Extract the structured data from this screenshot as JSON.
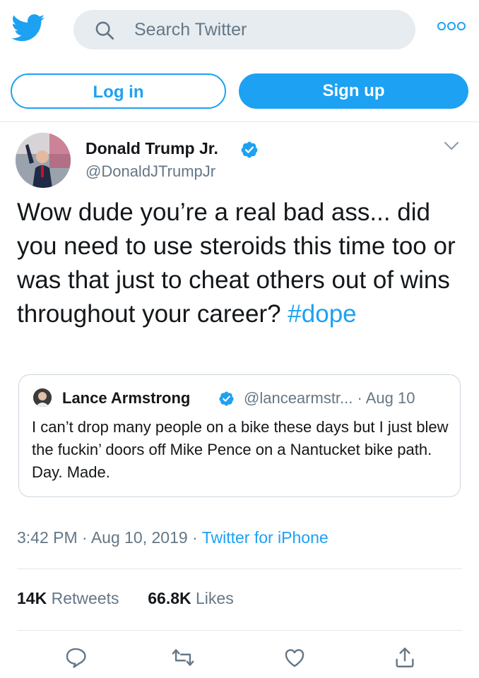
{
  "search": {
    "placeholder": "Search Twitter"
  },
  "auth": {
    "login_label": "Log in",
    "signup_label": "Sign up"
  },
  "tweet": {
    "author_name": "Donald Trump Jr.",
    "author_handle": "@DonaldJTrumpJr",
    "text_main": "Wow dude you’re a real bad ass... did you need to use steroids this time too or was that just to cheat others out of wins throughout your career? ",
    "hashtag": "#dope",
    "quote": {
      "author_name": "Lance Armstrong",
      "author_handle": "@lancearmstr... · Aug 10",
      "text": "I can’t drop many people on a bike these days but I just blew the fuckin’ doors off Mike Pence on a Nantucket bike path. Day. Made."
    },
    "time": "3:42 PM · Aug 10, 2019 · ",
    "source": "Twitter for iPhone",
    "retweets_count": "14K",
    "retweets_label": " Retweets",
    "likes_count": "66.8K",
    "likes_label": " Likes"
  },
  "icons": {
    "logo": "twitter-bird-icon",
    "search": "search-icon",
    "more": "more-dots-icon",
    "verified": "verified-badge-icon",
    "chevron": "chevron-down-icon",
    "reply": "reply-icon",
    "retweet": "retweet-icon",
    "like": "heart-icon",
    "share": "share-icon"
  },
  "colors": {
    "brand": "#1da1f2",
    "secondary_text": "#657786",
    "search_bg": "#e6ecf0"
  }
}
